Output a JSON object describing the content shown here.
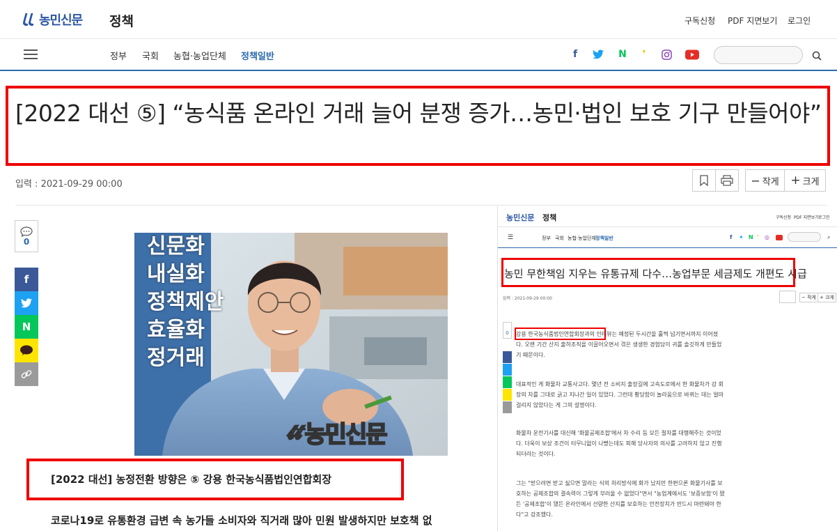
{
  "header": {
    "logo_text": "농민신문",
    "section": "정책",
    "utils": [
      "구독신청",
      "PDF 지면보기",
      "로그인"
    ]
  },
  "nav": {
    "items": [
      "정부",
      "국회",
      "농협·농업단체",
      "정책일반"
    ],
    "active": "정책일반",
    "social": [
      "facebook-icon",
      "twitter-icon",
      "naver-icon",
      "kakaostory-icon",
      "instagram-icon",
      "youtube-icon"
    ]
  },
  "article": {
    "headline": "[2022 대선 ⑤] “농식품 온라인 거래 늘어 분쟁 증가…농민·법인 보호 기구 만들어야”",
    "date": "입력 : 2021-09-29 00:00",
    "font_small": "작게",
    "font_large": "크게",
    "comment_count": "0",
    "caption": "[2022 대선] 농정전환 방향은 ⑤ 강용 한국농식품법인연합회장",
    "lead": "코로나19로 유통환경 급변 속 농가들 소비자와 직거래 많아 민원 발생하지만 보호책 없",
    "watermark": "농민신문"
  },
  "photo_bg_text": [
    "신문화",
    "내실화",
    "정책제안",
    "효율화",
    "정거래"
  ],
  "inset": {
    "logo_text": "농민신문",
    "section": "정책",
    "utils": [
      "구독신청",
      "PDF 지면보기",
      "로그인"
    ],
    "nav": [
      "정부",
      "국회",
      "농협·농업단체",
      "정책일반"
    ],
    "headline": "농민 무한책임 지우는 유통규제 다수…농업부문 세금제도 개편도 시급",
    "date": "입력 : 2021-09-29 00:00",
    "font_small": "작게",
    "font_large": "크게",
    "comment_count": "0",
    "paragraphs": [
      "강용 한국농식품법인연합회장과의 인터뷰는 예정된 두시간을 훌쩍 넘기면서까지 이어졌다. 오랜 기간 산지 출하조직을 이끌어오면서 겪은 생생한 경험담이 귀를 솔깃하게 만들었기 때문이다.",
      "대표적인 게 화물차 교통사고다. 몇년 전 소비지 출장길에 고속도로에서 한 화물차가 강 회장의 차를 그대로 긁고 지나간 일이 있었다. 그런데 황당함이 놀라움으로 바뀌는 데는 얼마 걸리지 않았다는 게 그의 설명이다.",
      "화물차 운전기사를 대신해 '화물공제조합'에서 차 수리 등 모든 절차를 대행해주는 것이었다. 더욱이 보상 조건이 터무니없이 나빴는데도 피해 당사자의 의사를 고려하지 않고 진행되더라는 것이다.",
      "그는 \"받으려면 받고 싫으면 말라는 식의 처리방식에 화가 났지만 한편으론 화물기사를 보호하는 공제조합의 결속력이 그렇게 부러울 수 없었다\"면서 \"농업계에서도 '보증보험'이 됐든 '공제조합'이 됐든 온라인에서 선량한 산지를 보호하는 안전장치가 반드시 마련돼야 한다\"고 강조했다."
    ],
    "highlight": "강용 한국농식품법인연합회장과의 인터뷰"
  },
  "colors": {
    "brand": "#2b56a6",
    "accent": "#2b6ab0",
    "highlight_border": "#e00000",
    "facebook": "#3b5998",
    "twitter": "#1da1f2",
    "naver": "#03c75a",
    "kakao": "#fee500",
    "youtube": "#e52d27"
  }
}
